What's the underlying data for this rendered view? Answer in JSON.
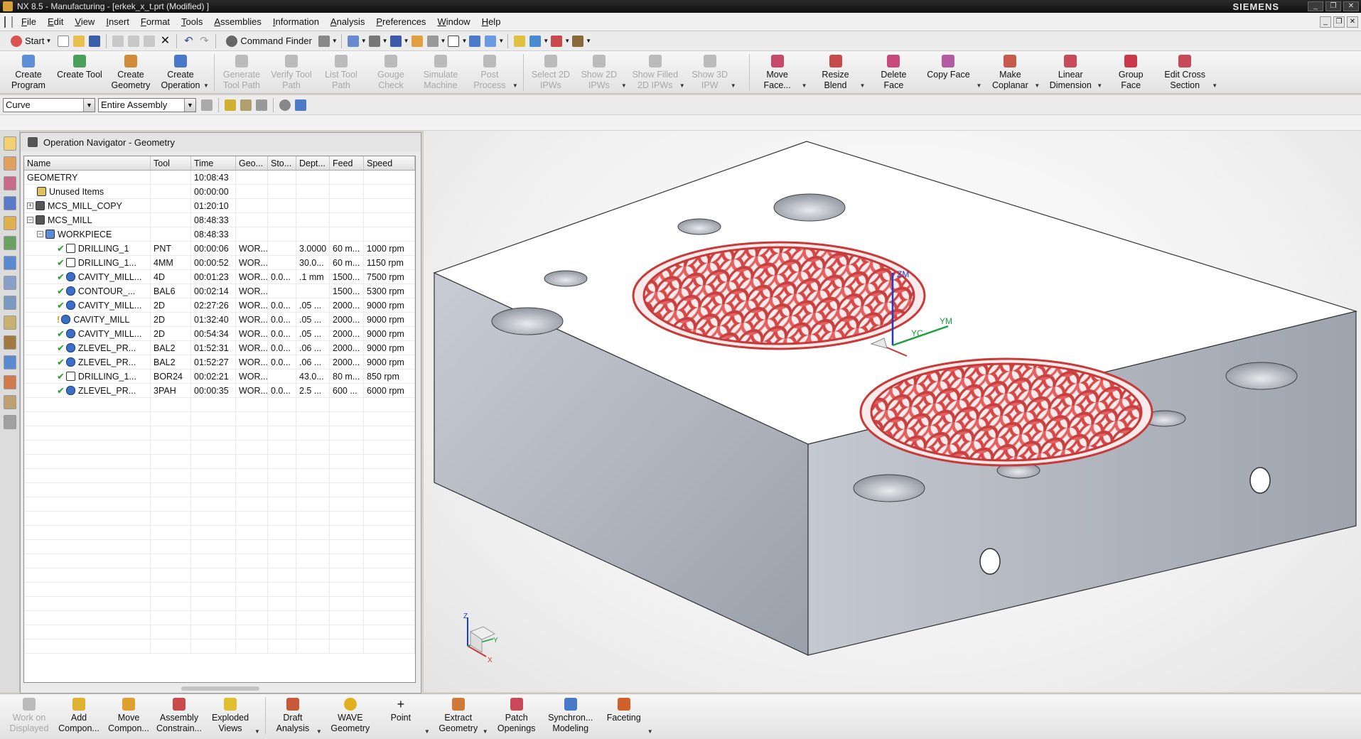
{
  "window": {
    "title": "NX 8.5 - Manufacturing - [erkek_x_t.prt (Modified) ]",
    "brand": "SIEMENS"
  },
  "menu": [
    "File",
    "Edit",
    "View",
    "Insert",
    "Format",
    "Tools",
    "Assemblies",
    "Information",
    "Analysis",
    "Preferences",
    "Window",
    "Help"
  ],
  "standard_toolbar": {
    "start_label": "Start",
    "command_finder_label": "Command Finder"
  },
  "big_toolbar": [
    {
      "label": "Create Program",
      "enabled": true,
      "color": "#5b8fd6"
    },
    {
      "label": "Create Tool",
      "enabled": true,
      "color": "#4aa05a"
    },
    {
      "label": "Create Geometry",
      "enabled": true,
      "color": "#d08a3a"
    },
    {
      "label": "Create Operation",
      "enabled": true,
      "color": "#4a78c8"
    },
    {
      "label": "Generate Tool Path",
      "enabled": false,
      "color": "#bbbbbb"
    },
    {
      "label": "Verify Tool Path",
      "enabled": false,
      "color": "#bbbbbb"
    },
    {
      "label": "List Tool Path",
      "enabled": false,
      "color": "#bbbbbb"
    },
    {
      "label": "Gouge Check",
      "enabled": false,
      "color": "#bbbbbb"
    },
    {
      "label": "Simulate Machine",
      "enabled": false,
      "color": "#bbbbbb"
    },
    {
      "label": "Post Process",
      "enabled": false,
      "color": "#bbbbbb"
    },
    {
      "label": "Select 2D IPWs",
      "enabled": false,
      "color": "#bbbbbb"
    },
    {
      "label": "Show 2D IPWs",
      "enabled": false,
      "color": "#bbbbbb"
    },
    {
      "label": "Show Filled 2D IPWs",
      "enabled": false,
      "color": "#bbbbbb"
    },
    {
      "label": "Show 3D IPW",
      "enabled": false,
      "color": "#bbbbbb"
    },
    {
      "label": "Move Face...",
      "enabled": true,
      "color": "#c84a6a"
    },
    {
      "label": "Resize Blend",
      "enabled": true,
      "color": "#c84a4a"
    },
    {
      "label": "Delete Face",
      "enabled": true,
      "color": "#c84a7a"
    },
    {
      "label": "Copy Face",
      "enabled": true,
      "color": "#b45aa0"
    },
    {
      "label": "Make Coplanar",
      "enabled": true,
      "color": "#c85a4a"
    },
    {
      "label": "Linear Dimension",
      "enabled": true,
      "color": "#c84a5a"
    },
    {
      "label": "Group Face",
      "enabled": true,
      "color": "#c83a4a"
    },
    {
      "label": "Edit Cross Section",
      "enabled": true,
      "color": "#c84a5a"
    }
  ],
  "selection_bar": {
    "filter": "Curve",
    "scope": "Entire Assembly"
  },
  "navigator": {
    "title": "Operation Navigator - Geometry",
    "columns": [
      "Name",
      "Tool",
      "Time",
      "Geo...",
      "Sto...",
      "Dept...",
      "Feed",
      "Speed"
    ],
    "rows": [
      {
        "indent": 0,
        "expand": "",
        "status": "",
        "icon": "",
        "name": "GEOMETRY",
        "tool": "",
        "time": "10:08:43",
        "geo": "",
        "sto": "",
        "dep": "",
        "feed": "",
        "speed": ""
      },
      {
        "indent": 1,
        "expand": "",
        "status": "",
        "icon": "geo",
        "name": "Unused Items",
        "tool": "",
        "time": "00:00:00",
        "geo": "",
        "sto": "",
        "dep": "",
        "feed": "",
        "speed": ""
      },
      {
        "indent": 0,
        "expand": "+",
        "status": "",
        "icon": "mcs",
        "name": "MCS_MILL_COPY",
        "tool": "",
        "time": "01:20:10",
        "geo": "",
        "sto": "",
        "dep": "",
        "feed": "",
        "speed": ""
      },
      {
        "indent": 0,
        "expand": "−",
        "status": "",
        "icon": "mcs",
        "name": "MCS_MILL",
        "tool": "",
        "time": "08:48:33",
        "geo": "",
        "sto": "",
        "dep": "",
        "feed": "",
        "speed": ""
      },
      {
        "indent": 1,
        "expand": "−",
        "status": "",
        "icon": "wp",
        "name": "WORKPIECE",
        "tool": "",
        "time": "08:48:33",
        "geo": "",
        "sto": "",
        "dep": "",
        "feed": "",
        "speed": ""
      },
      {
        "indent": 3,
        "expand": "",
        "status": "ok",
        "icon": "drill",
        "name": "DRILLING_1",
        "tool": "PNT",
        "time": "00:00:06",
        "geo": "WOR...",
        "sto": "",
        "dep": "3.0000",
        "feed": "60 m...",
        "speed": "1000 rpm"
      },
      {
        "indent": 3,
        "expand": "",
        "status": "ok",
        "icon": "drill",
        "name": "DRILLING_1...",
        "tool": "4MM",
        "time": "00:00:52",
        "geo": "WOR...",
        "sto": "",
        "dep": "30.0...",
        "feed": "60 m...",
        "speed": "1150 rpm"
      },
      {
        "indent": 3,
        "expand": "",
        "status": "ok",
        "icon": "mill",
        "name": "CAVITY_MILL...",
        "tool": "4D",
        "time": "00:01:23",
        "geo": "WOR...",
        "sto": "0.0...",
        "dep": ".1 mm",
        "feed": "1500...",
        "speed": "7500 rpm"
      },
      {
        "indent": 3,
        "expand": "",
        "status": "ok",
        "icon": "mill",
        "name": "CONTOUR_...",
        "tool": "BAL6",
        "time": "00:02:14",
        "geo": "WOR...",
        "sto": "",
        "dep": "",
        "feed": "1500...",
        "speed": "5300 rpm"
      },
      {
        "indent": 3,
        "expand": "",
        "status": "ok",
        "icon": "mill",
        "name": "CAVITY_MILL...",
        "tool": "2D",
        "time": "02:27:26",
        "geo": "WOR...",
        "sto": "0.0...",
        "dep": ".05 ...",
        "feed": "2000...",
        "speed": "9000 rpm"
      },
      {
        "indent": 3,
        "expand": "",
        "status": "warn",
        "icon": "mill",
        "name": "CAVITY_MILL",
        "tool": "2D",
        "time": "01:32:40",
        "geo": "WOR...",
        "sto": "0.0...",
        "dep": ".05 ...",
        "feed": "2000...",
        "speed": "9000 rpm"
      },
      {
        "indent": 3,
        "expand": "",
        "status": "ok",
        "icon": "mill",
        "name": "CAVITY_MILL...",
        "tool": "2D",
        "time": "00:54:34",
        "geo": "WOR...",
        "sto": "0.0...",
        "dep": ".05 ...",
        "feed": "2000...",
        "speed": "9000 rpm"
      },
      {
        "indent": 3,
        "expand": "",
        "status": "ok",
        "icon": "mill",
        "name": "ZLEVEL_PR...",
        "tool": "BAL2",
        "time": "01:52:31",
        "geo": "WOR...",
        "sto": "0.0...",
        "dep": ".06 ...",
        "feed": "2000...",
        "speed": "9000 rpm"
      },
      {
        "indent": 3,
        "expand": "",
        "status": "ok",
        "icon": "mill",
        "name": "ZLEVEL_PR...",
        "tool": "BAL2",
        "time": "01:52:27",
        "geo": "WOR...",
        "sto": "0.0...",
        "dep": ".06 ...",
        "feed": "2000...",
        "speed": "9000 rpm"
      },
      {
        "indent": 3,
        "expand": "",
        "status": "ok",
        "icon": "drill",
        "name": "DRILLING_1...",
        "tool": "BOR24",
        "time": "00:02:21",
        "geo": "WOR...",
        "sto": "",
        "dep": "43.0...",
        "feed": "80 m...",
        "speed": "850 rpm"
      },
      {
        "indent": 3,
        "expand": "",
        "status": "ok",
        "icon": "mill",
        "name": "ZLEVEL_PR...",
        "tool": "3PAH",
        "time": "00:00:35",
        "geo": "WOR...",
        "sto": "0.0...",
        "dep": "2.5 ...",
        "feed": "600 ...",
        "speed": "6000 rpm"
      }
    ]
  },
  "viewport": {
    "axis_labels": {
      "zm": "ZM",
      "yc": "YC",
      "ym": "YM",
      "z": "Z",
      "x": "X",
      "y": "Y"
    },
    "colors": {
      "part_top": "#ffffff",
      "part_side": "#b4bac4",
      "pattern": "#e05050"
    }
  },
  "bottom_toolbar": [
    {
      "label": "Work on Displayed",
      "enabled": false,
      "color": "#bbbbbb"
    },
    {
      "label": "Add Compon...",
      "enabled": true,
      "color": "#e0b030"
    },
    {
      "label": "Move Compon...",
      "enabled": true,
      "color": "#e0a030"
    },
    {
      "label": "Assembly Constrain...",
      "enabled": true,
      "color": "#c84a4a"
    },
    {
      "label": "Exploded Views",
      "enabled": true,
      "color": "#e0c030"
    },
    {
      "label": "Draft Analysis",
      "enabled": true,
      "color": "#c85a3a"
    },
    {
      "label": "WAVE Geometry",
      "enabled": true,
      "color": "#e0b020"
    },
    {
      "label": "Point",
      "enabled": true,
      "color": "#555555"
    },
    {
      "label": "Extract Geometry",
      "enabled": true,
      "color": "#d07a3a"
    },
    {
      "label": "Patch Openings",
      "enabled": true,
      "color": "#c84a5a"
    },
    {
      "label": "Synchron... Modeling",
      "enabled": true,
      "color": "#4a78c8"
    },
    {
      "label": "Faceting",
      "enabled": true,
      "color": "#d0602a"
    }
  ]
}
